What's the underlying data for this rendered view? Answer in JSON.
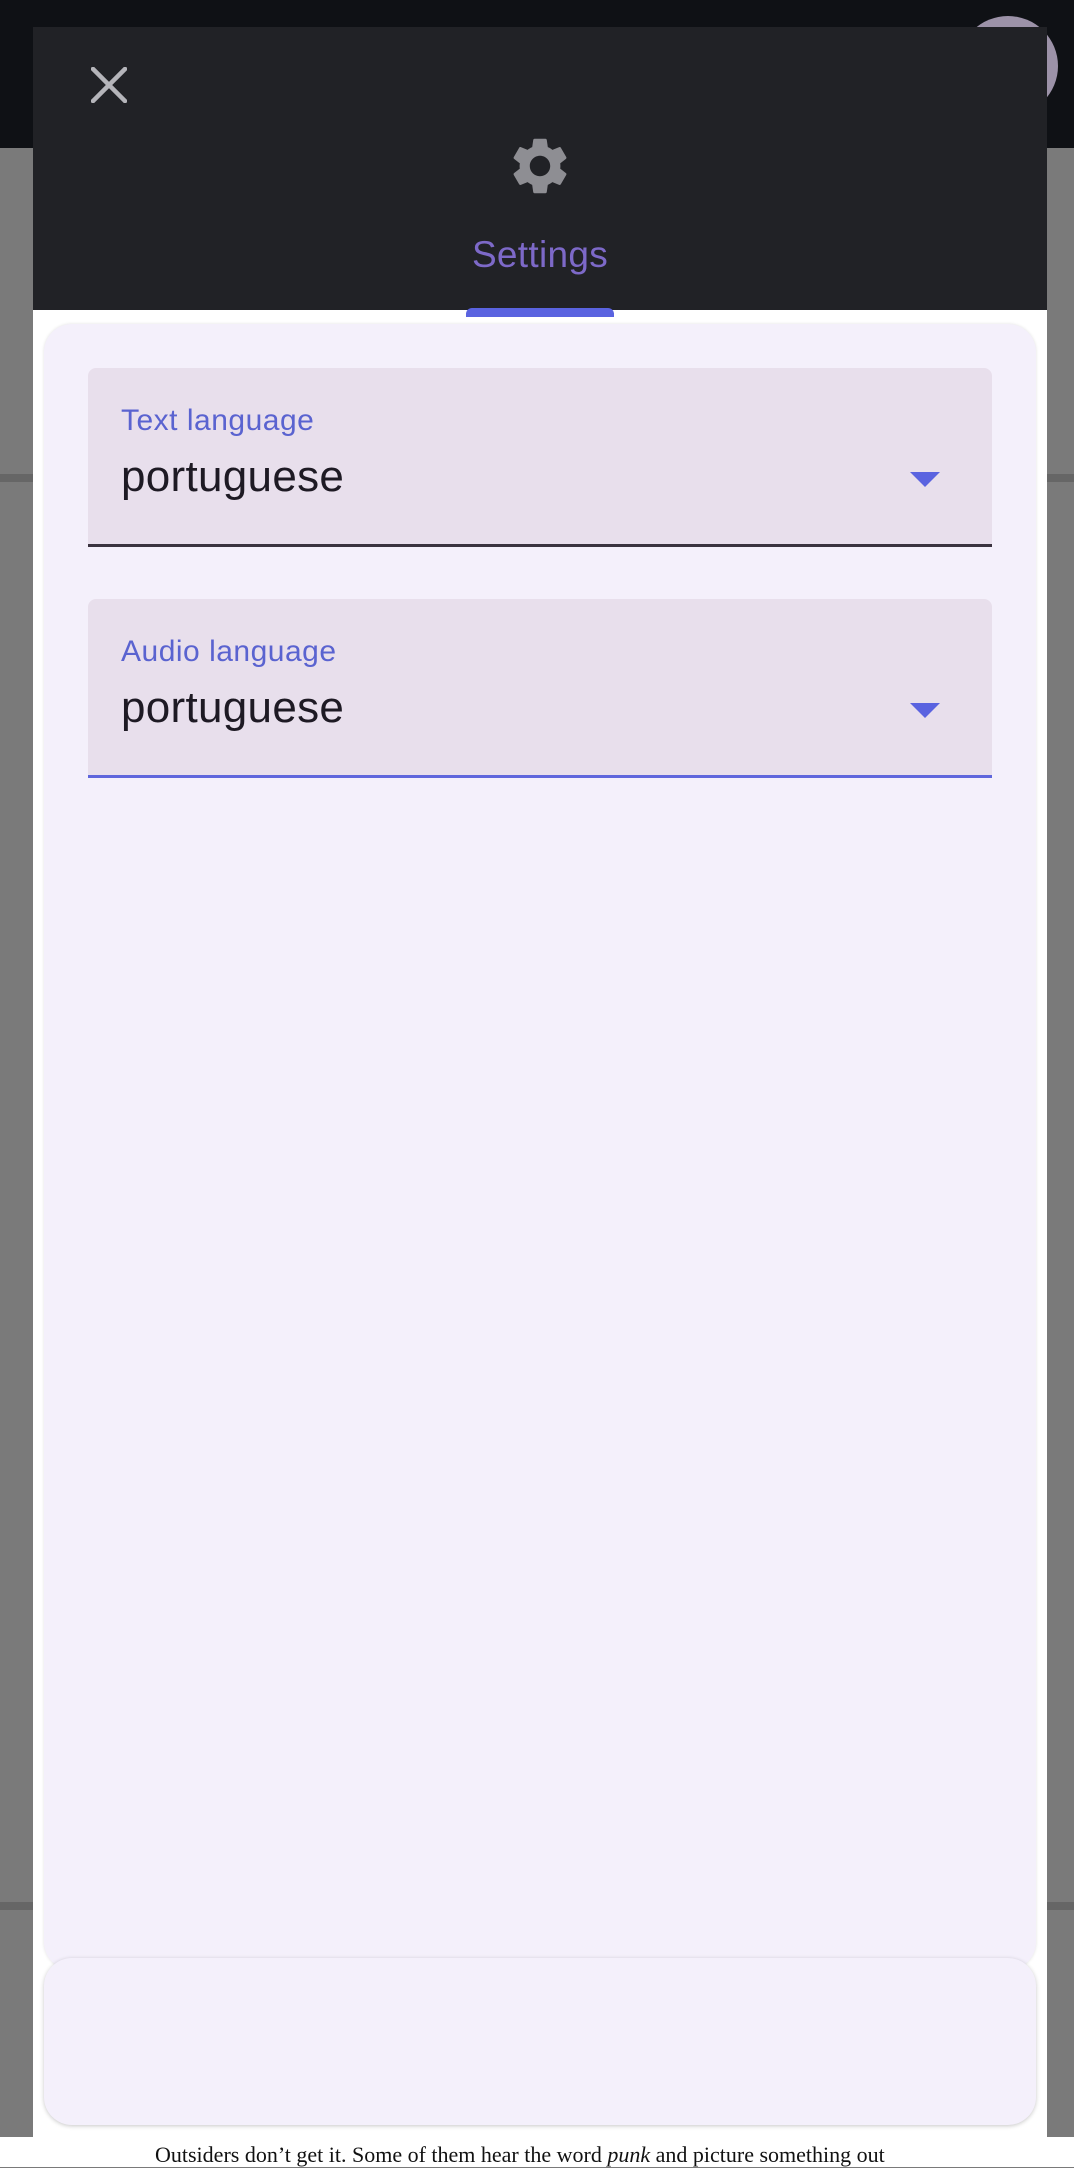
{
  "background": {
    "bottom_text_before": "Outsiders don’t get it. Some of them hear the word ",
    "bottom_text_emphasis": "punk",
    "bottom_text_after": " and picture something out"
  },
  "settings_dialog": {
    "close_icon": "close-icon",
    "tab_icon": "gear-icon",
    "tab_label": "Settings",
    "fields": [
      {
        "label": "Text language",
        "value": "portuguese",
        "icon": "chevron-down-icon"
      },
      {
        "label": "Audio language",
        "value": "portuguese",
        "icon": "chevron-down-icon"
      }
    ]
  },
  "colors": {
    "header_bg": "#212226",
    "accent": "#5a63e0",
    "tab_label": "#7d69c8",
    "panel_bg": "#f4f0fb",
    "field_bg": "#e8dfec"
  }
}
